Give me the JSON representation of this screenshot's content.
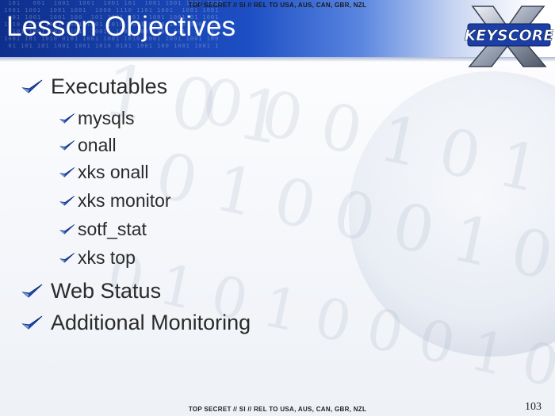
{
  "classification": {
    "top": "TOP SECRET // SI // REL TO USA, AUS, CAN, GBR, NZL",
    "bottom": "TOP SECRET // SI // REL TO USA, AUS, CAN, GBR, NZL"
  },
  "slide": {
    "title": "Lesson Objectives",
    "page_number": "103",
    "logo_text": "KEYSCORE",
    "bullets": [
      {
        "label": "Executables",
        "level": 1
      },
      {
        "label": "mysqls",
        "level": 2
      },
      {
        "label": "onall",
        "level": 2
      },
      {
        "label": "xks onall",
        "level": 2
      },
      {
        "label": "xks monitor",
        "level": 2
      },
      {
        "label": "sotf_stat",
        "level": 2
      },
      {
        "label": "xks top",
        "level": 2
      },
      {
        "label": "Web Status",
        "level": 1
      },
      {
        "label": "Additional Monitoring",
        "level": 1
      }
    ]
  },
  "colors": {
    "header_blue": "#1d4fc4",
    "check_blue": "#1e4fc0",
    "text": "#2a2a2a"
  },
  "icons": {
    "bullet": "checkmark-icon",
    "logo": "keyscore-x-logo"
  }
}
